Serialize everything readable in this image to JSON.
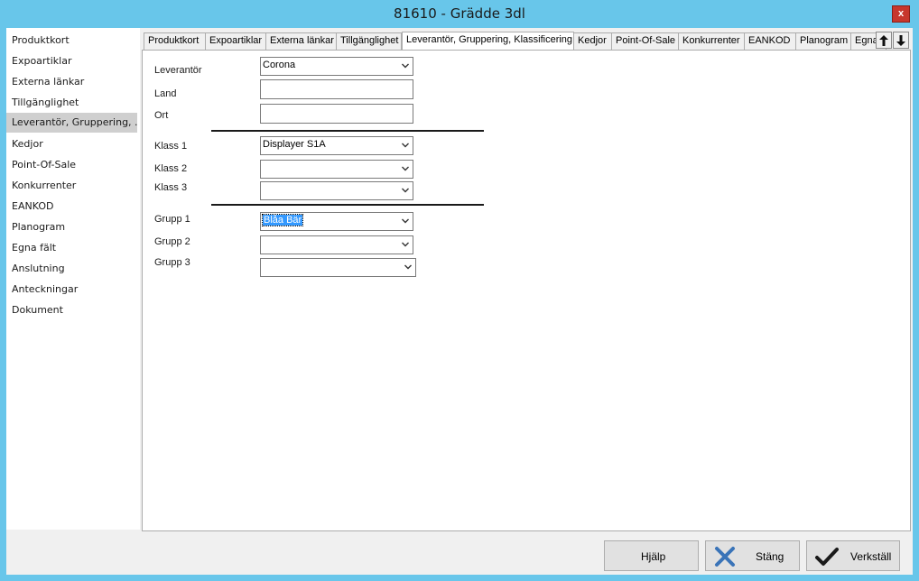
{
  "window": {
    "title": "81610 - Grädde 3dl",
    "close_label": "x"
  },
  "sidebar": {
    "items": [
      {
        "label": "Produktkort"
      },
      {
        "label": "Expoartiklar"
      },
      {
        "label": "Externa länkar"
      },
      {
        "label": "Tillgänglighet"
      },
      {
        "label": "Leverantör, Gruppering, ..."
      },
      {
        "label": "Kedjor"
      },
      {
        "label": "Point-Of-Sale"
      },
      {
        "label": "Konkurrenter"
      },
      {
        "label": "EANKOD"
      },
      {
        "label": "Planogram"
      },
      {
        "label": "Egna fält"
      },
      {
        "label": "Anslutning"
      },
      {
        "label": "Anteckningar"
      },
      {
        "label": "Dokument"
      }
    ],
    "selected_index": 4
  },
  "tabs": [
    {
      "label": "Produktkort"
    },
    {
      "label": "Expoartiklar"
    },
    {
      "label": "Externa länkar"
    },
    {
      "label": "Tillgänglighet"
    },
    {
      "label": "Leverantör, Gruppering, Klassificering"
    },
    {
      "label": "Kedjor"
    },
    {
      "label": "Point-Of-Sale"
    },
    {
      "label": "Konkurrenter"
    },
    {
      "label": "EANKOD"
    },
    {
      "label": "Planogram"
    },
    {
      "label": "Egna"
    }
  ],
  "active_tab_index": 4,
  "form": {
    "leverantor": {
      "label": "Leverantör",
      "value": "Corona"
    },
    "land": {
      "label": "Land",
      "value": ""
    },
    "ort": {
      "label": "Ort",
      "value": ""
    },
    "klass1": {
      "label": "Klass 1",
      "value": "Displayer S1A"
    },
    "klass2": {
      "label": "Klass 2",
      "value": ""
    },
    "klass3": {
      "label": "Klass 3",
      "value": ""
    },
    "grupp1": {
      "label": "Grupp 1",
      "value": "Blåa Bär"
    },
    "grupp2": {
      "label": "Grupp 2",
      "value": ""
    },
    "grupp3": {
      "label": "Grupp 3",
      "value": ""
    }
  },
  "buttons": {
    "help": "Hjälp",
    "close": "Stäng",
    "execute": "Verkställ"
  },
  "icons": {
    "scroll_up": "arrow-up-icon",
    "scroll_down": "arrow-down-icon",
    "close": "x-icon",
    "check": "check-icon"
  },
  "colors": {
    "title_bar": "#68c6ea",
    "selection": "#3399ff",
    "close_icon": "#3a74b8"
  }
}
